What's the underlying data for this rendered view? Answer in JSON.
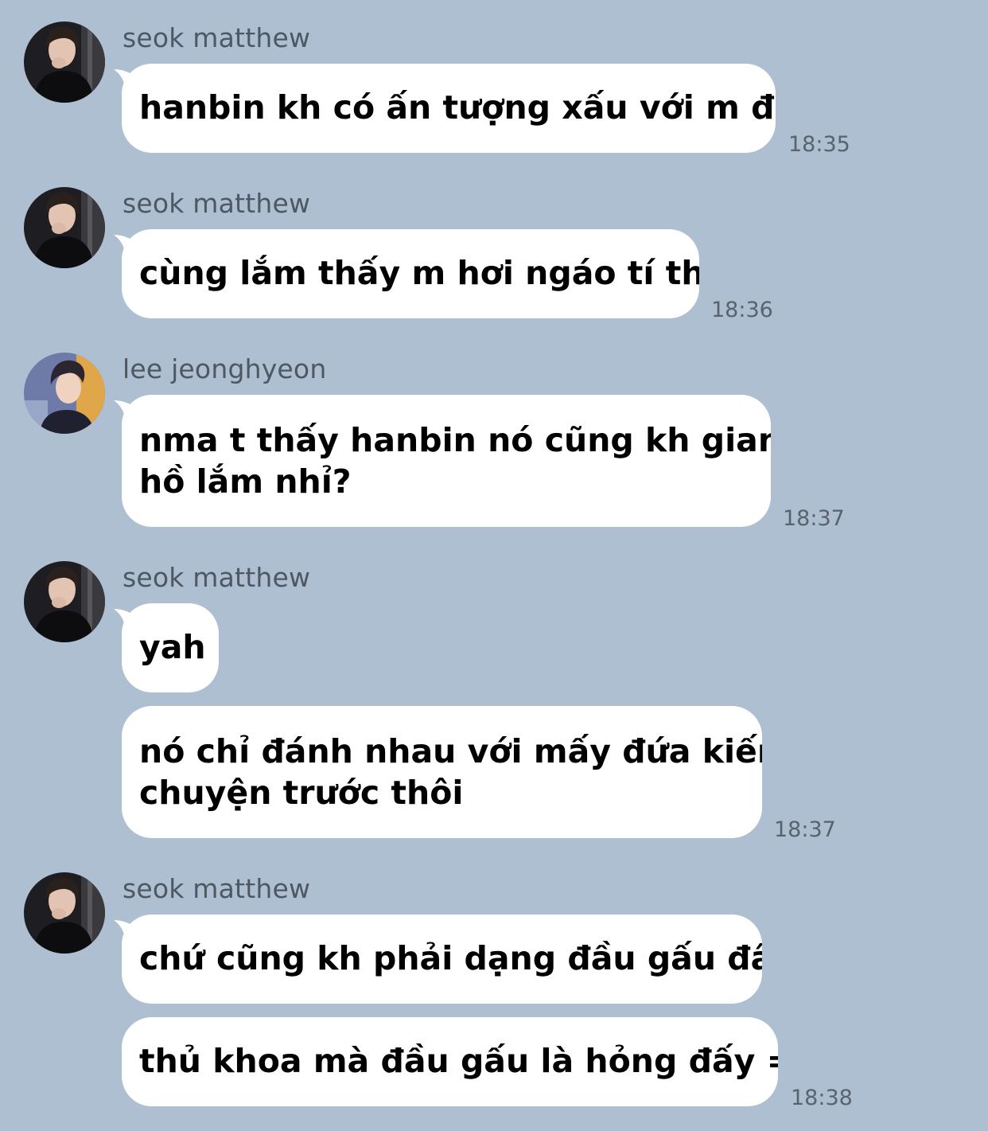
{
  "colors": {
    "background": "#adbfd1",
    "bubble": "#ffffff",
    "sender_text": "#4e5862",
    "time_text": "#59636d"
  },
  "messages": [
    {
      "sender": "seok matthew",
      "avatar": "avatar-seok-matthew",
      "text": "hanbin kh có ấn tượng xấu với m đâu",
      "time": "18:35"
    },
    {
      "sender": "seok matthew",
      "avatar": "avatar-seok-matthew",
      "text": "cùng lắm thấy m hơi ngáo tí thôi",
      "time": "18:36"
    },
    {
      "sender": "lee jeonghyeon",
      "avatar": "avatar-lee-jeonghyeon",
      "lines": [
        "nma t thấy hanbin nó cũng kh giang",
        "hồ lắm nhỉ?"
      ],
      "time": "18:37"
    },
    {
      "sender": "seok matthew",
      "avatar": "avatar-seok-matthew",
      "text": "yah"
    },
    {
      "lines": [
        "nó chỉ đánh nhau với mấy đứa kiếm",
        "chuyện trước thôi"
      ],
      "time": "18:37"
    },
    {
      "sender": "seok matthew",
      "avatar": "avatar-seok-matthew",
      "text": "chứ cũng kh phải dạng đầu gấu đâu"
    },
    {
      "text": "thủ khoa mà đầu gấu là hỏng đấy =))",
      "time": "18:38"
    }
  ]
}
